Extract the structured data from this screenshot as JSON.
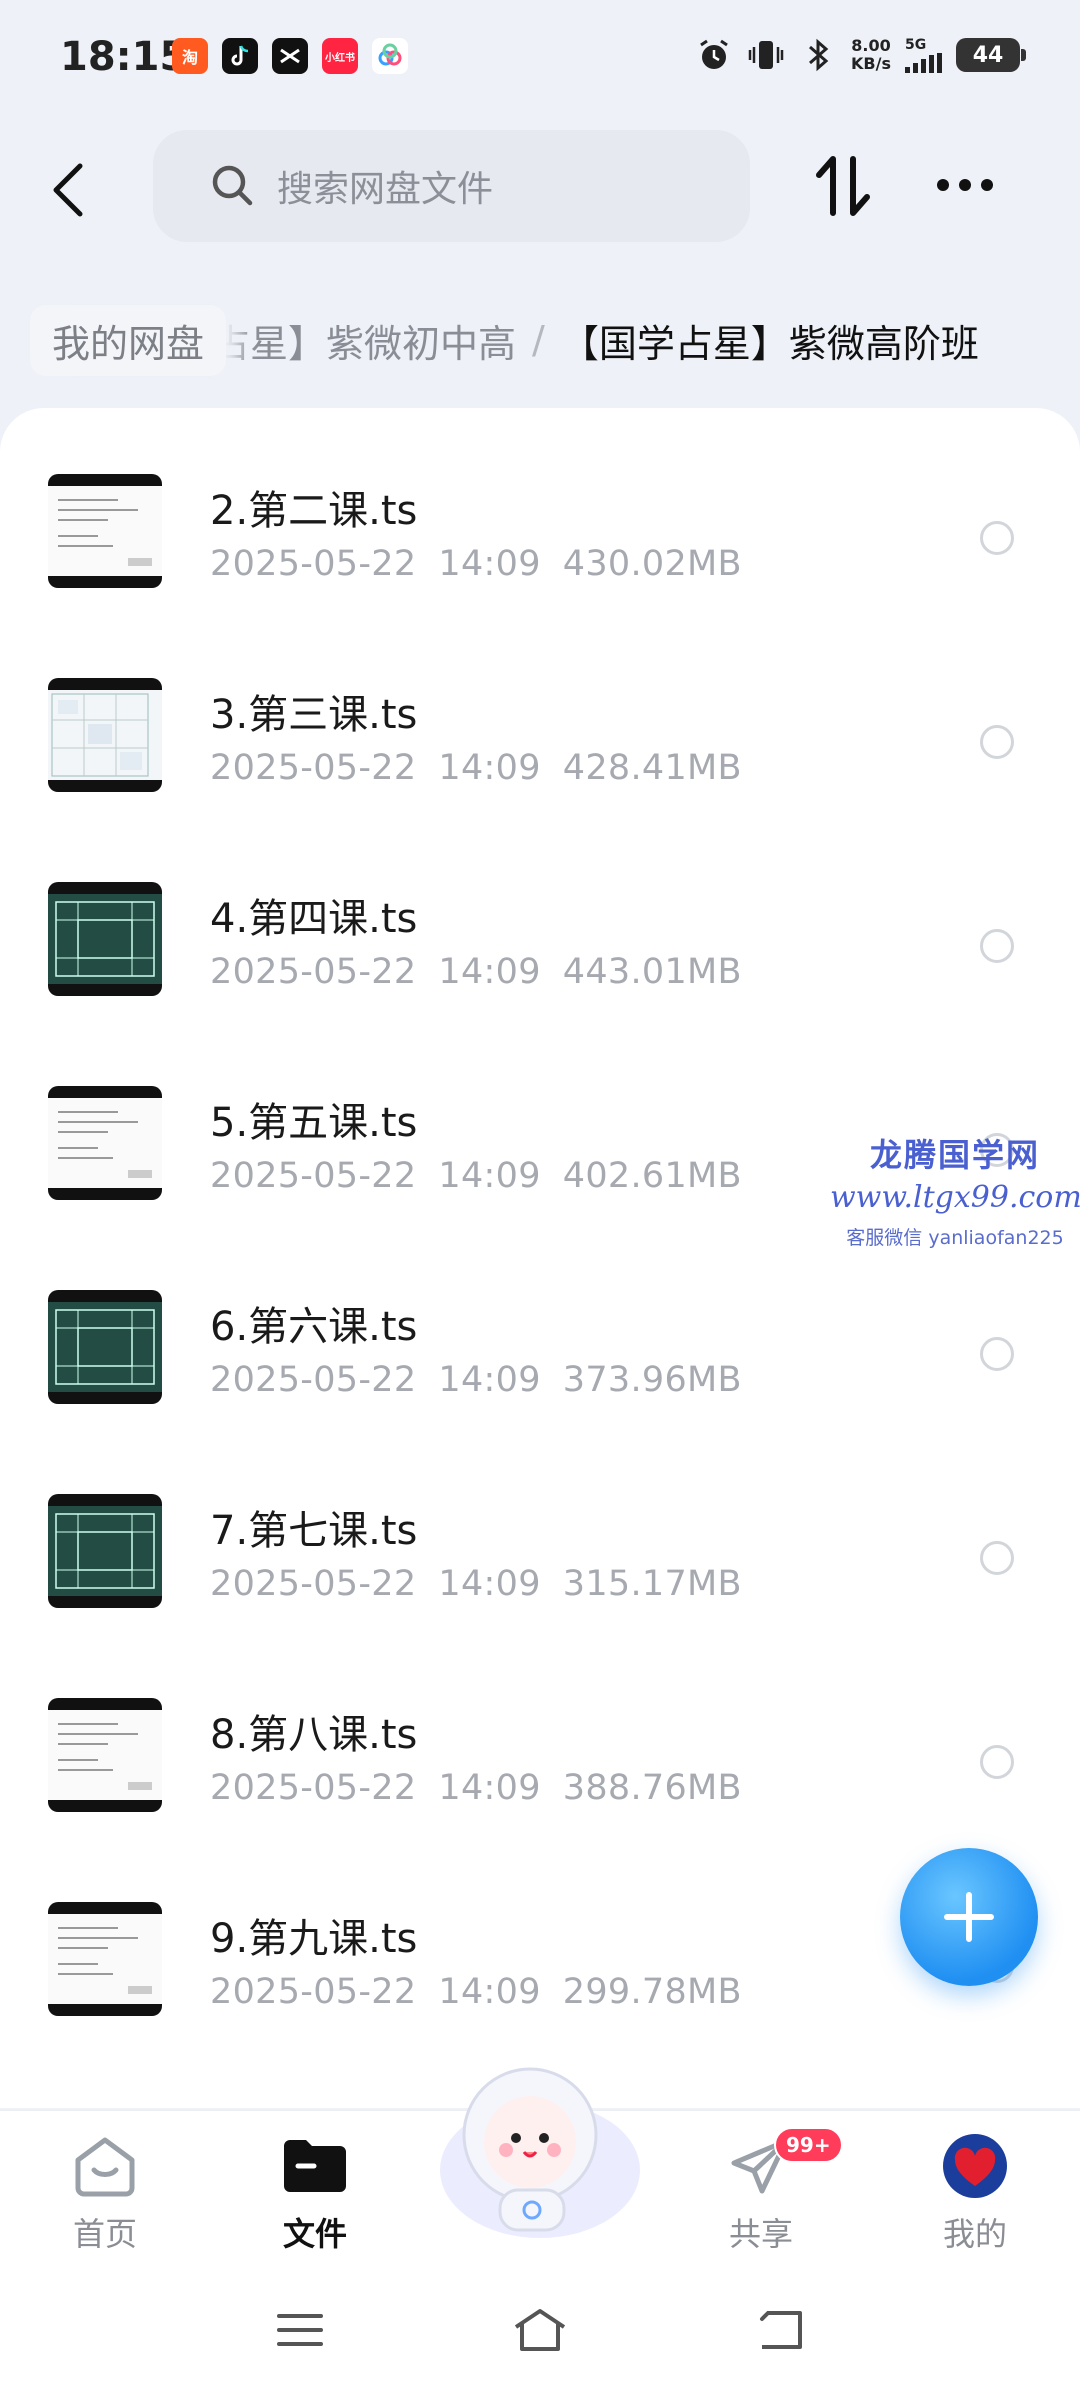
{
  "status_bar": {
    "time": "18:15",
    "net_speed_value": "8.00",
    "net_speed_unit": "KB/s",
    "network_type": "5G",
    "battery": "44",
    "apps": [
      "taobao-icon",
      "douyin-icon",
      "capcut-icon",
      "xiaohongshu-icon",
      "baidu-netdisk-icon"
    ],
    "taobao_text": "淘",
    "xhs_text": "小红书"
  },
  "search": {
    "placeholder": "搜索网盘文件"
  },
  "breadcrumb": {
    "root": "我的网盘",
    "middle_fragment": "占星】紫微初中高",
    "separator": "/",
    "current": "【国学占星】紫微高阶班"
  },
  "files": [
    {
      "name": "2.第二课.ts",
      "date": "2025-05-22",
      "time": "14:09",
      "size": "430.02MB",
      "thumb": "doc"
    },
    {
      "name": "3.第三课.ts",
      "date": "2025-05-22",
      "time": "14:09",
      "size": "428.41MB",
      "thumb": "chart"
    },
    {
      "name": "4.第四课.ts",
      "date": "2025-05-22",
      "time": "14:09",
      "size": "443.01MB",
      "thumb": "board"
    },
    {
      "name": "5.第五课.ts",
      "date": "2025-05-22",
      "time": "14:09",
      "size": "402.61MB",
      "thumb": "doc"
    },
    {
      "name": "6.第六课.ts",
      "date": "2025-05-22",
      "time": "14:09",
      "size": "373.96MB",
      "thumb": "board"
    },
    {
      "name": "7.第七课.ts",
      "date": "2025-05-22",
      "time": "14:09",
      "size": "315.17MB",
      "thumb": "board"
    },
    {
      "name": "8.第八课.ts",
      "date": "2025-05-22",
      "time": "14:09",
      "size": "388.76MB",
      "thumb": "doc"
    },
    {
      "name": "9.第九课.ts",
      "date": "2025-05-22",
      "time": "14:09",
      "size": "299.78MB",
      "thumb": "doc"
    }
  ],
  "watermark": {
    "title": "龙腾国学网",
    "url": "www.ltgx99.com",
    "contact": "客服微信 yanliaofan225"
  },
  "bottom_nav": {
    "home": "首页",
    "files": "文件",
    "share": "共享",
    "share_badge": "99+",
    "mine": "我的"
  },
  "colors": {
    "accent": "#1f8ff2",
    "badge": "#ff3d5a",
    "watermark": "#4a5fd0"
  }
}
